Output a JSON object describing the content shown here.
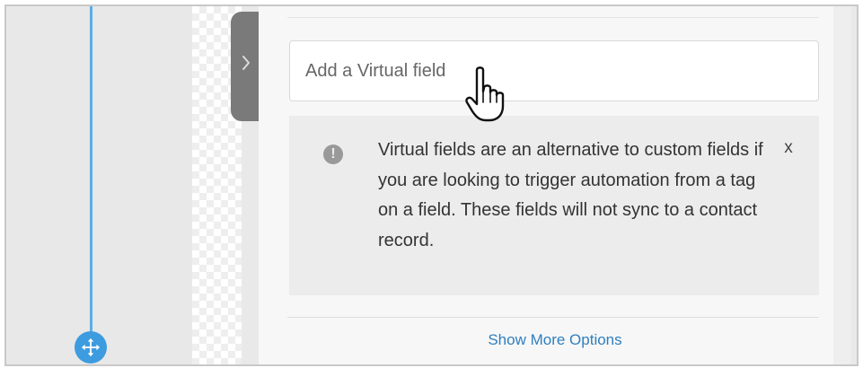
{
  "virtual_field": {
    "placeholder": "Add a Virtual field"
  },
  "info": {
    "message": "Virtual fields are an alternative to custom fields if you are looking to trigger automation from a tag on a field. These fields will not sync to a contact record.",
    "close_label": "x",
    "icon": "exclamation-circle-icon"
  },
  "options": {
    "show_more_label": "Show More Options"
  },
  "icons": {
    "collapse": "chevron-right-icon",
    "move": "move-arrows-icon",
    "cursor": "hand-pointer-icon"
  },
  "colors": {
    "flow_line": "#5aaee6",
    "move_handle": "#3d9be0",
    "link": "#2f7fbf"
  }
}
